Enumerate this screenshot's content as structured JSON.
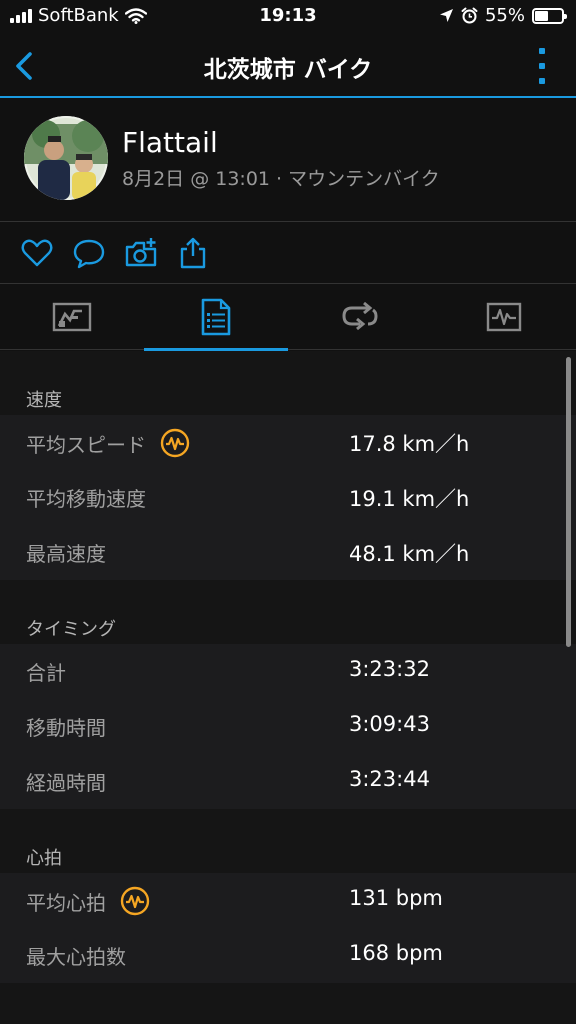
{
  "status_bar": {
    "carrier": "SoftBank",
    "time": "19:13",
    "battery": "55%",
    "battery_level": 0.55
  },
  "nav": {
    "title": "北茨城市 バイク",
    "back_icon": "chevron-left-icon",
    "more_icon": "vertical-dots-icon"
  },
  "activity": {
    "user_name": "Flattail",
    "meta": "8月2日 @ 13:01 · マウンテンバイク"
  },
  "actions": [
    "heart-icon",
    "comment-icon",
    "camera-add-icon",
    "share-icon"
  ],
  "tabs": [
    {
      "name": "overview-icon",
      "active": false
    },
    {
      "name": "stats-icon",
      "active": true
    },
    {
      "name": "laps-icon",
      "active": false
    },
    {
      "name": "charts-icon",
      "active": false
    }
  ],
  "sections": [
    {
      "title": "速度",
      "rows": [
        {
          "label": "平均スピード",
          "value": "17.8 km／h",
          "badge": true
        },
        {
          "label": "平均移動速度",
          "value": "19.1 km／h",
          "badge": false
        },
        {
          "label": "最高速度",
          "value": "48.1 km／h",
          "badge": false
        }
      ]
    },
    {
      "title": "タイミング",
      "rows": [
        {
          "label": "合計",
          "value": "3:23:32",
          "badge": false
        },
        {
          "label": "移動時間",
          "value": "3:09:43",
          "badge": false
        },
        {
          "label": "経過時間",
          "value": "3:23:44",
          "badge": false
        }
      ]
    },
    {
      "title": "心拍",
      "rows": [
        {
          "label": "平均心拍",
          "value": "131 bpm",
          "badge": true
        },
        {
          "label": "最大心拍数",
          "value": "168 bpm",
          "badge": false
        }
      ]
    }
  ],
  "colors": {
    "accent": "#1a9ae0",
    "badge": "#f5a623",
    "background": "#111111",
    "row_background": "#1c1c1e"
  }
}
